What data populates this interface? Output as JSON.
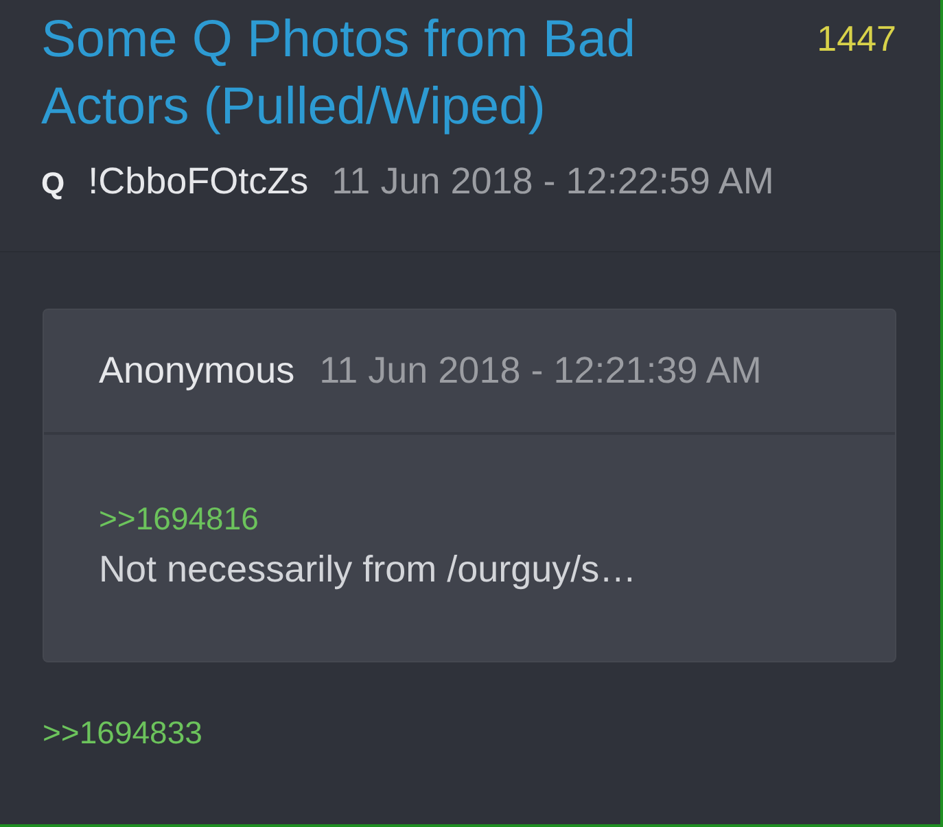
{
  "post": {
    "title": "Some Q Photos from Bad Actors (Pulled/Wiped)",
    "number": "1447",
    "author": "Q",
    "tripcode": "!CbboFOtcZs",
    "timestamp": "11 Jun 2018 - 12:22:59 AM"
  },
  "quoted_post": {
    "author": "Anonymous",
    "timestamp": "11 Jun 2018 - 12:21:39 AM",
    "body": [
      {
        "kind": "reference",
        "text": ">>1694816"
      },
      {
        "kind": "text",
        "text": "Not necessarily from /ourguy/s…"
      }
    ]
  },
  "body": [
    {
      "kind": "reference",
      "text": ">>1694833"
    }
  ]
}
